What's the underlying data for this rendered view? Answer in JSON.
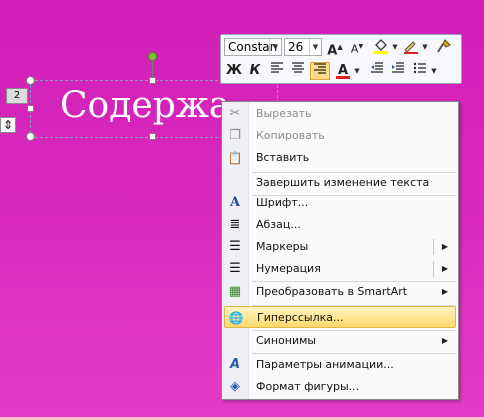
{
  "slide": {
    "title_text": "Содержание",
    "slide_number": "2",
    "resize_glyph": "⇕"
  },
  "mini_toolbar": {
    "font_name": "Constan",
    "font_size": "26",
    "grow_font": "A",
    "shrink_font": "A",
    "bold": "Ж",
    "italic": "К",
    "font_color_letter": "A",
    "dropdown_glyph": "▼",
    "icons": {
      "grow": "grow-font-icon",
      "shrink": "shrink-font-icon",
      "fill": "fill-color-icon",
      "outline": "outline-color-icon",
      "brush": "format-painter-icon",
      "align_left": "align-left-icon",
      "center": "align-center-icon",
      "align_right": "align-right-icon",
      "font_color": "font-color-icon",
      "indent_dec": "decrease-indent-icon",
      "indent_inc": "increase-indent-icon",
      "bullets": "bullets-icon"
    }
  },
  "context_menu": {
    "items": [
      {
        "label": "Вырезать",
        "icon": "scissors-icon",
        "glyph": "✂",
        "disabled": true
      },
      {
        "label": "Копировать",
        "icon": "copy-icon",
        "glyph": "❐",
        "disabled": true
      },
      {
        "label": "Вставить",
        "icon": "paste-icon",
        "glyph": "📋",
        "disabled": false
      },
      {
        "label": "Завершить изменение текста",
        "icon": "",
        "glyph": "",
        "disabled": false
      },
      {
        "label": "Шрифт...",
        "icon": "font-icon",
        "glyph": "A",
        "disabled": false
      },
      {
        "label": "Абзац...",
        "icon": "paragraph-icon",
        "glyph": "≣",
        "disabled": false
      },
      {
        "label": "Маркеры",
        "icon": "bullets-icon",
        "glyph": "☰",
        "disabled": false
      },
      {
        "label": "Нумерация",
        "icon": "numbering-icon",
        "glyph": "☰",
        "disabled": false
      },
      {
        "label": "Преобразовать в SmartArt",
        "icon": "smartart-icon",
        "glyph": "▦",
        "disabled": false
      },
      {
        "label": "Гиперссылка...",
        "icon": "hyperlink-icon",
        "glyph": "🌐",
        "disabled": false
      },
      {
        "label": "Синонимы",
        "icon": "",
        "glyph": "",
        "disabled": false
      },
      {
        "label": "Параметры анимации...",
        "icon": "animation-icon",
        "glyph": "A",
        "disabled": false
      },
      {
        "label": "Формат фигуры...",
        "icon": "format-shape-icon",
        "glyph": "◈",
        "disabled": false
      }
    ],
    "submenu_glyph": "▶",
    "highlight_color": "#ffd96b"
  },
  "colors": {
    "background": "#d828bd",
    "font_color_swatch": "#e02020",
    "highlight_swatch": "#ffff00"
  }
}
